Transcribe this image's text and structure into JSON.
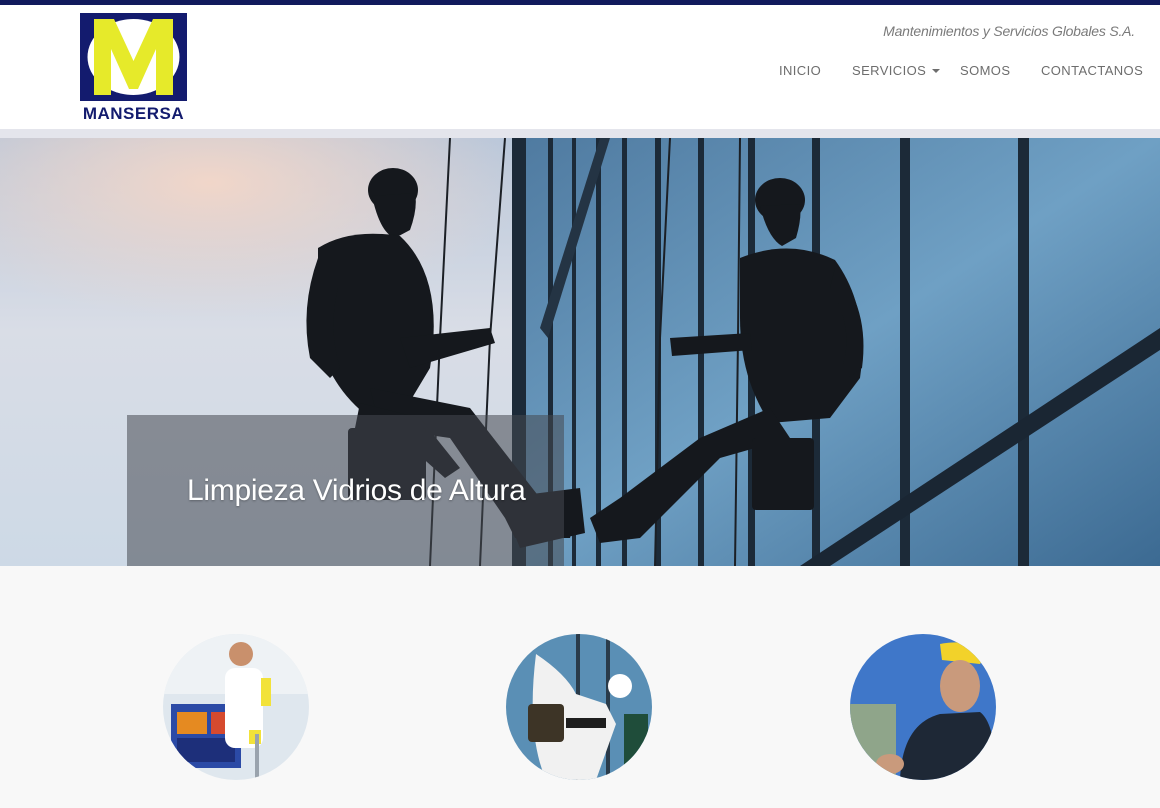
{
  "brand": {
    "logo_text": "MANSERSA",
    "logo_letter": "M",
    "tagline": "Mantenimientos y Servicios Globales S.A."
  },
  "nav": {
    "items": [
      {
        "label": "INICIO"
      },
      {
        "label": "SERVICIOS",
        "has_dropdown": true
      },
      {
        "label": "SOMOS"
      },
      {
        "label": "CONTACTANOS"
      }
    ]
  },
  "hero": {
    "caption": "Limpieza Vidrios de Altura"
  },
  "services": [
    {
      "image": "cleaning-cart-worker-photo"
    },
    {
      "image": "harness-worker-photo"
    },
    {
      "image": "helmet-worker-photo"
    }
  ],
  "colors": {
    "brand_navy": "#111a5c",
    "brand_yellow": "#e6ea2a",
    "text_gray": "#6d6d6d"
  }
}
